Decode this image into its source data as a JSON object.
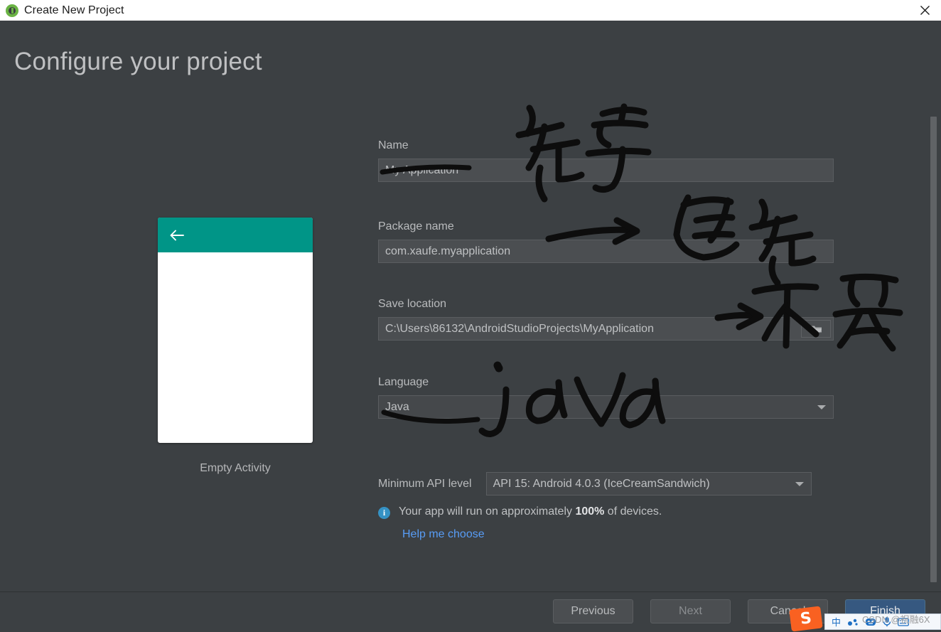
{
  "window": {
    "title": "Create New Project",
    "app_icon": "android-studio-icon",
    "close_icon": "close-icon"
  },
  "page": {
    "heading": "Configure your project"
  },
  "preview": {
    "back_icon": "arrow-left-icon",
    "appbar_color": "#009587",
    "label": "Empty Activity"
  },
  "form": {
    "name": {
      "label": "Name",
      "value": "My Application"
    },
    "package_name": {
      "label": "Package name",
      "value": "com.xaufe.myapplication"
    },
    "save_location": {
      "label": "Save location",
      "value": "C:\\Users\\86132\\AndroidStudioProjects\\MyApplication",
      "browse_icon": "folder-icon"
    },
    "language": {
      "label": "Language",
      "value": "Java",
      "chevron_icon": "chevron-down-icon"
    },
    "min_api": {
      "label": "Minimum API level",
      "value": "API 15: Android 4.0.3 (IceCreamSandwich)",
      "chevron_icon": "chevron-down-icon"
    },
    "info": {
      "icon": "info-icon",
      "prefix": "Your app will run on approximately ",
      "percent": "100%",
      "suffix": " of devices.",
      "help_link": "Help me choose"
    }
  },
  "footer": {
    "previous": "Previous",
    "next": "Next",
    "cancel": "Cancel",
    "finish": "Finish",
    "primary_color": "#365880"
  },
  "annotations": {
    "name_note": "名字",
    "package_note": "包名",
    "location_note": "不变",
    "language_note": "java"
  },
  "ime": {
    "logo": "S",
    "mode": "中",
    "icons": [
      "sogou-logo-icon",
      "chinese-mode-icon",
      "color-dots-icon",
      "emoji-icon",
      "microphone-icon",
      "keyboard-icon"
    ]
  },
  "watermark": "CSDN @祝融6X"
}
